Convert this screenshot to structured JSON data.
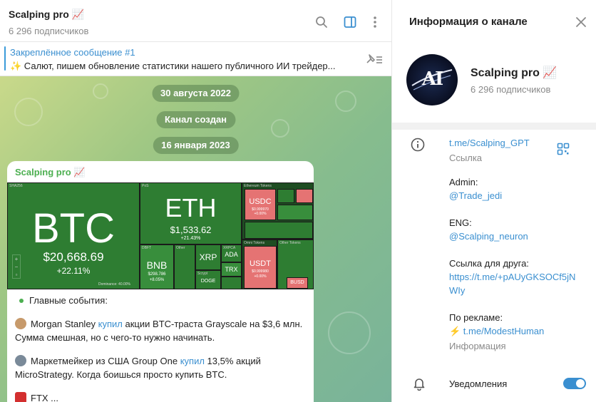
{
  "chat": {
    "title": "Scalping pro 📈",
    "subscribers": "6 296 подписчиков",
    "pinned": {
      "title": "Закреплённое сообщение #1",
      "text": "✨ Салют, пишем обновление статистики нашего публичного ИИ трейдер..."
    },
    "date_pills": [
      "30 августа 2022",
      "Канал создан",
      "16 января 2023"
    ],
    "message": {
      "author": "Scalping pro 📈",
      "heatmap": {
        "section_labels": [
          "SHA256",
          "PoS",
          "Ethereum Tokens",
          "Omni Tokens",
          "Other Tokens",
          "DBFT",
          "Other",
          "XRPCA",
          "Scrypt"
        ],
        "tiles": [
          {
            "symbol": "BTC",
            "price": "$20,668.69",
            "change": "+22.11%",
            "color": "#2e7d32"
          },
          {
            "symbol": "ETH",
            "price": "$1,533.62",
            "change": "+21.43%",
            "color": "#2e7d32"
          },
          {
            "symbol": "BNB",
            "price": "$298.786",
            "change": "+8.05%",
            "color": "#388e3c"
          },
          {
            "symbol": "XRP",
            "price": "",
            "change": "",
            "color": "#2e7d32"
          },
          {
            "symbol": "ADA",
            "price": "",
            "change": "",
            "color": "#2e7d32"
          },
          {
            "symbol": "TRX",
            "price": "",
            "change": "",
            "color": "#388e3c"
          },
          {
            "symbol": "DOGE",
            "price": "",
            "change": "",
            "color": "#2e7d32"
          },
          {
            "symbol": "USDC",
            "price": "$0.999970",
            "change": "+0.00%",
            "color": "#e57373"
          },
          {
            "symbol": "USDT",
            "price": "$0.999980",
            "change": "+0.00%",
            "color": "#e57373"
          },
          {
            "symbol": "BUSD",
            "price": "",
            "change": "",
            "color": "#e57373"
          }
        ],
        "footnote": "Dominance: 40.00%"
      },
      "bullet_title": "Главные события:",
      "item1": {
        "lead": "Morgan Stanley ",
        "link": "купил",
        "rest": " акции BTC-траста Grayscale на $3,6 млн. Сумма смешная, но с чего-то нужно начинать."
      },
      "item2": {
        "lead": "Маркетмейкер из США Group One ",
        "link": "купил",
        "rest": " 13,5% акций MicroStrategy. Когда боишься просто купить BTC."
      },
      "item3_partial": "FTX ..."
    }
  },
  "info": {
    "title": "Информация о канале",
    "name": "Scalping pro 📈",
    "subscribers": "6 296 подписчиков",
    "avatar_text": "AI",
    "link": {
      "value": "t.me/Scalping_GPT",
      "caption": "Ссылка"
    },
    "admin": {
      "label": "Admin:",
      "value": "@Trade_jedi"
    },
    "eng": {
      "label": "ENG:",
      "value": "@Scalping_neuron"
    },
    "friend": {
      "label": "Ссылка для друга:",
      "line1": "https://t.me/+pAUyGKSOCf5jN",
      "line2": "WIy"
    },
    "ads": {
      "label": "По рекламе:",
      "value": "⚡ t.me/ModestHuman",
      "caption": "Информация"
    },
    "notifications": {
      "label": "Уведомления",
      "enabled": true
    }
  },
  "colors": {
    "accent": "#3a8fd0",
    "author_green": "#4caf50",
    "toggle_on": "#3a8fd0"
  }
}
